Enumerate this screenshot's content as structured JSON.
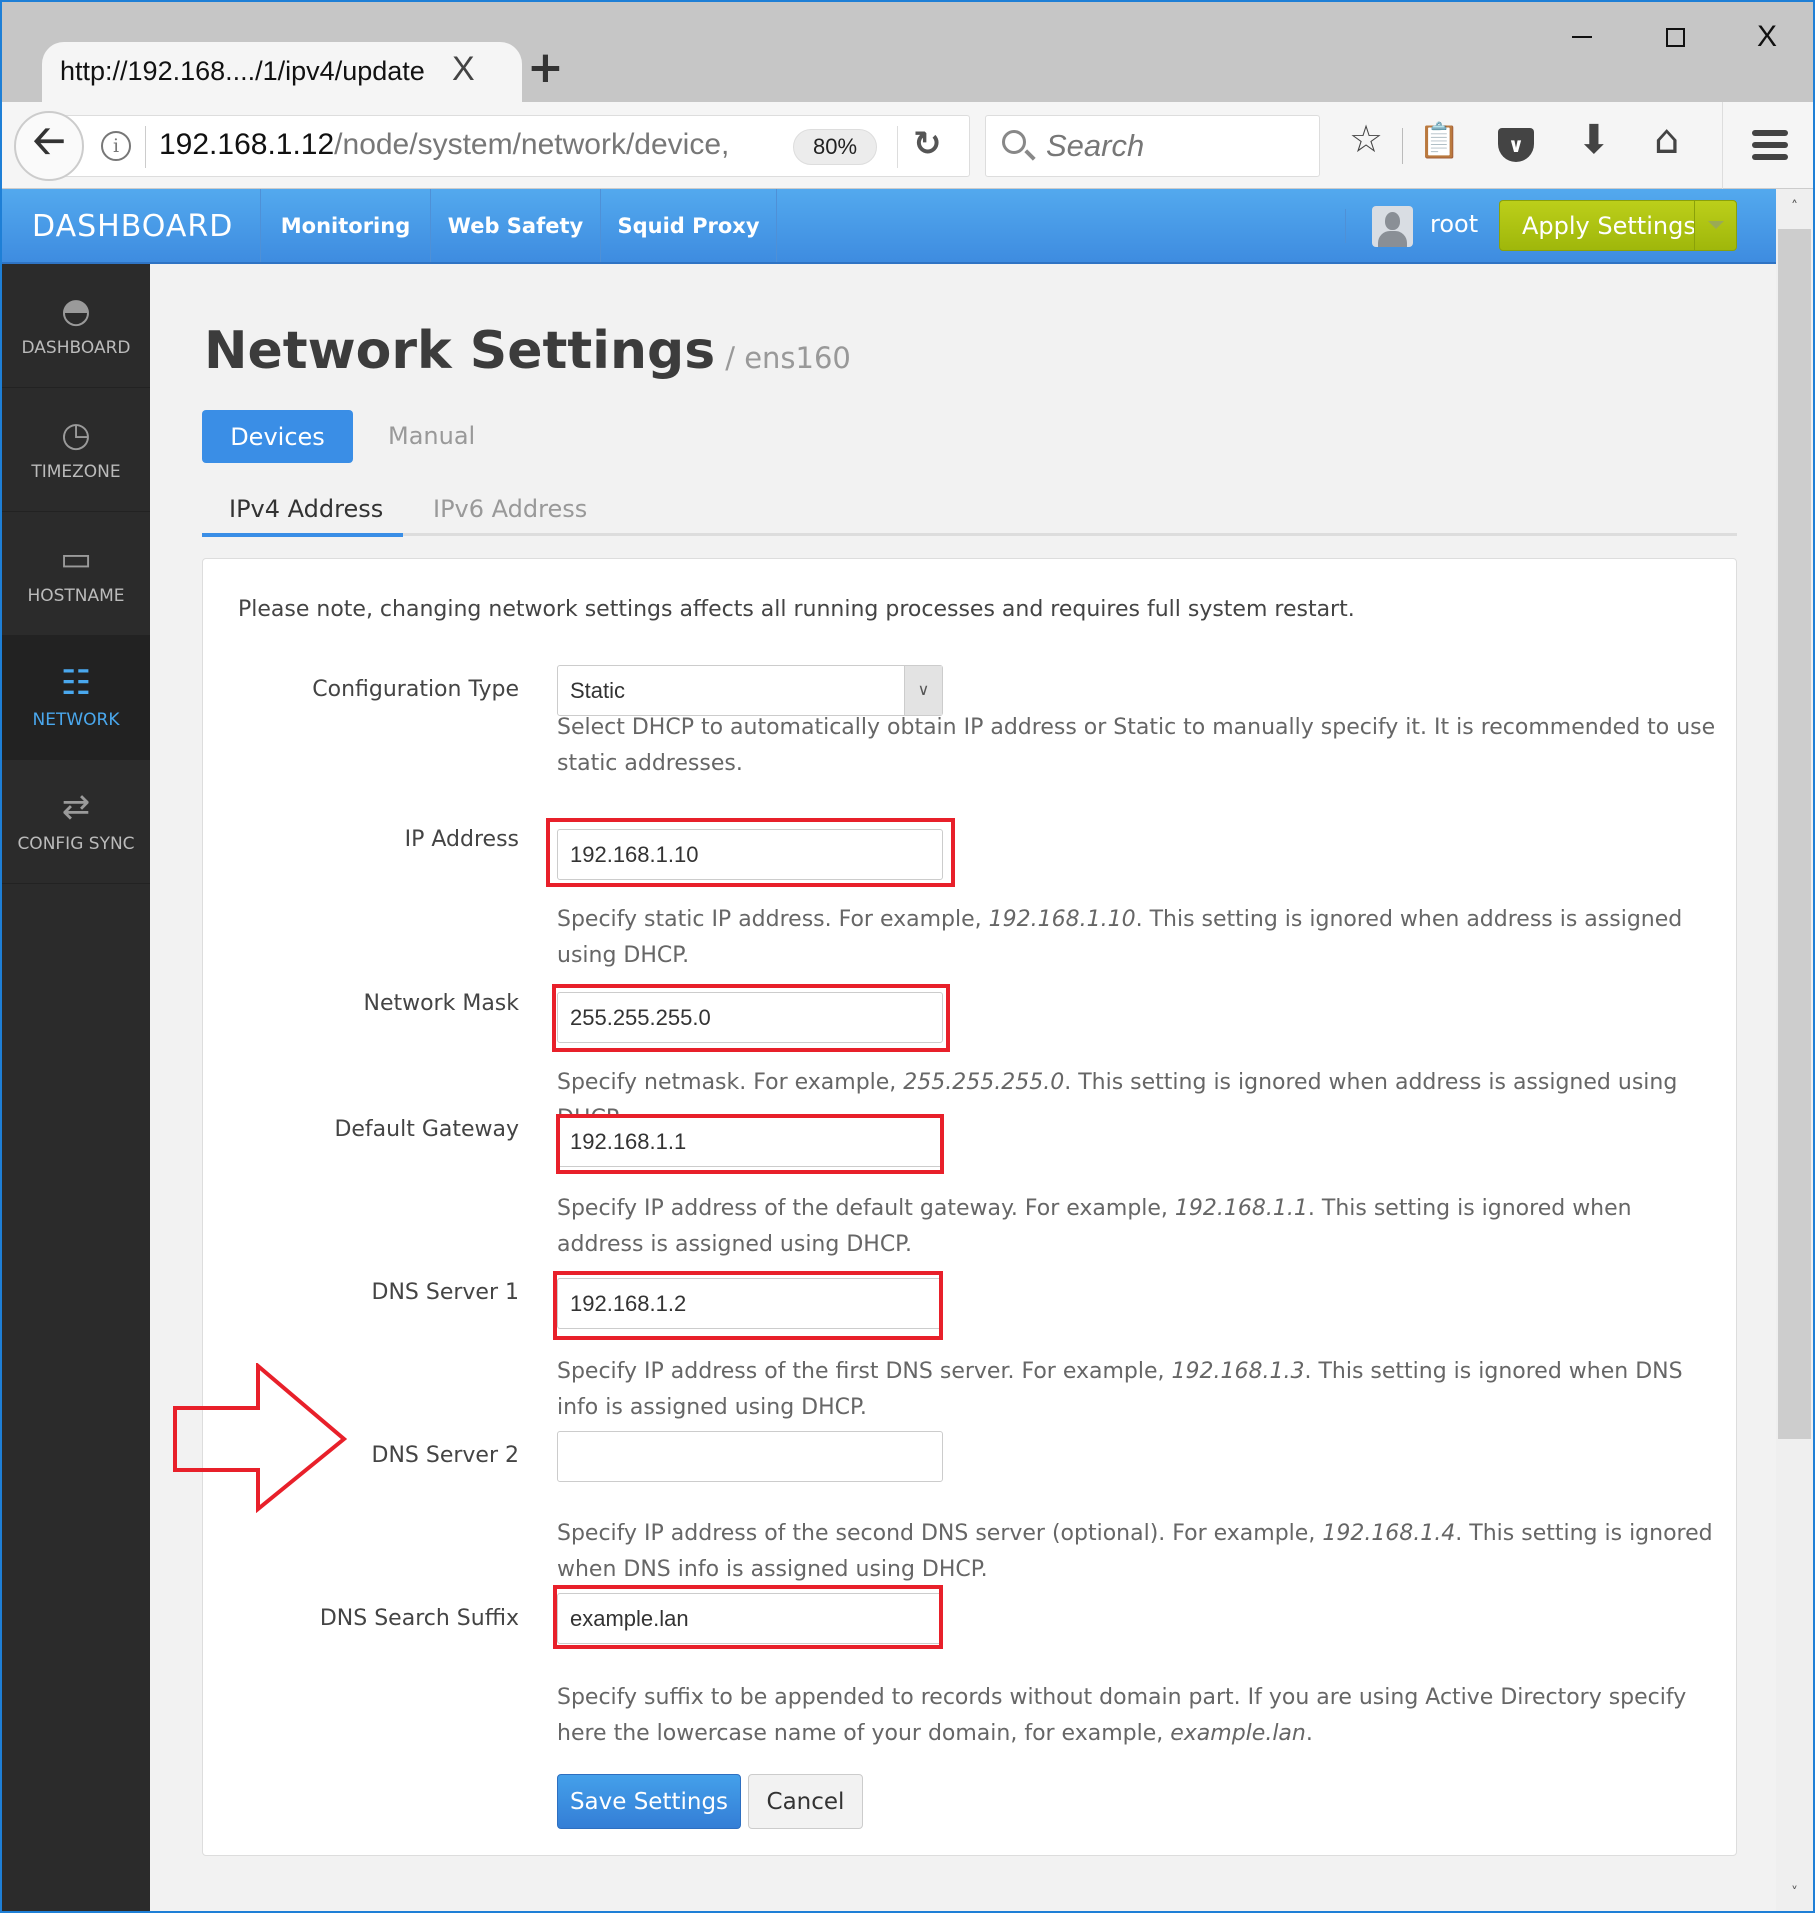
{
  "browser": {
    "tab_title": "http://192.168..../1/ipv4/update",
    "tab_close": "X",
    "new_tab": "+",
    "url_host": "192.168.1.12",
    "url_path": "/node/system/network/device,",
    "zoom_level": "80%",
    "search_placeholder": "Search",
    "window_close": "X"
  },
  "header": {
    "brand": "DASHBOARD",
    "nav": [
      "Monitoring",
      "Web Safety",
      "Squid Proxy"
    ],
    "username": "root",
    "apply_label": "Apply Settings",
    "accent_color": "#3a8ee6",
    "apply_color": "#a8c011"
  },
  "sidebar": {
    "items": [
      {
        "label": "DASHBOARD",
        "icon": "gauge-icon",
        "active": false
      },
      {
        "label": "TIMEZONE",
        "icon": "clock-icon",
        "active": false
      },
      {
        "label": "HOSTNAME",
        "icon": "hard-drive-icon",
        "active": false
      },
      {
        "label": "NETWORK",
        "icon": "sitemap-icon",
        "active": true
      },
      {
        "label": "CONFIG SYNC",
        "icon": "exchange-icon",
        "active": false
      }
    ]
  },
  "main": {
    "title": "Network Settings",
    "subtitle": "/ ens160",
    "pills": [
      "Devices",
      "Manual"
    ],
    "tabs": [
      "IPv4 Address",
      "IPv6 Address"
    ],
    "note": "Please note, changing network settings affects all running processes and requires full system restart.",
    "fields": {
      "config_type": {
        "label": "Configuration Type",
        "value": "Static",
        "help": "Select DHCP to automatically obtain IP address or Static to manually specify it. It is recommended to use static addresses."
      },
      "ip_address": {
        "label": "IP Address",
        "value": "192.168.1.10",
        "help_pre": "Specify static IP address. For example, ",
        "help_example": "192.168.1.10",
        "help_post": ". This setting is ignored when address is assigned using DHCP."
      },
      "netmask": {
        "label": "Network Mask",
        "value": "255.255.255.0",
        "help_pre": "Specify netmask. For example, ",
        "help_example": "255.255.255.0",
        "help_post": ". This setting is ignored when address is assigned using DHCP."
      },
      "gateway": {
        "label": "Default Gateway",
        "value": "192.168.1.1",
        "help_pre": "Specify IP address of the default gateway. For example, ",
        "help_example": "192.168.1.1",
        "help_post": ". This setting is ignored when address is assigned using DHCP."
      },
      "dns1": {
        "label": "DNS Server 1",
        "value": "192.168.1.2",
        "help_pre": "Specify IP address of the first DNS server. For example, ",
        "help_example": "192.168.1.3",
        "help_post": ". This setting is ignored when DNS info is assigned using DHCP."
      },
      "dns2": {
        "label": "DNS Server 2",
        "value": "",
        "help_pre": "Specify IP address of the second DNS server (optional). For example, ",
        "help_example": "192.168.1.4",
        "help_post": ". This setting is ignored when DNS info is assigned using DHCP."
      },
      "dns_suffix": {
        "label": "DNS Search Suffix",
        "value": "example.lan",
        "help_pre": "Specify suffix to be appended to records without domain part. If you are using Active Directory specify here the lowercase name of your domain, for example, ",
        "help_example": "example.lan",
        "help_post": "."
      }
    },
    "save_label": "Save Settings",
    "cancel_label": "Cancel",
    "annotation_color": "#e8202a"
  }
}
